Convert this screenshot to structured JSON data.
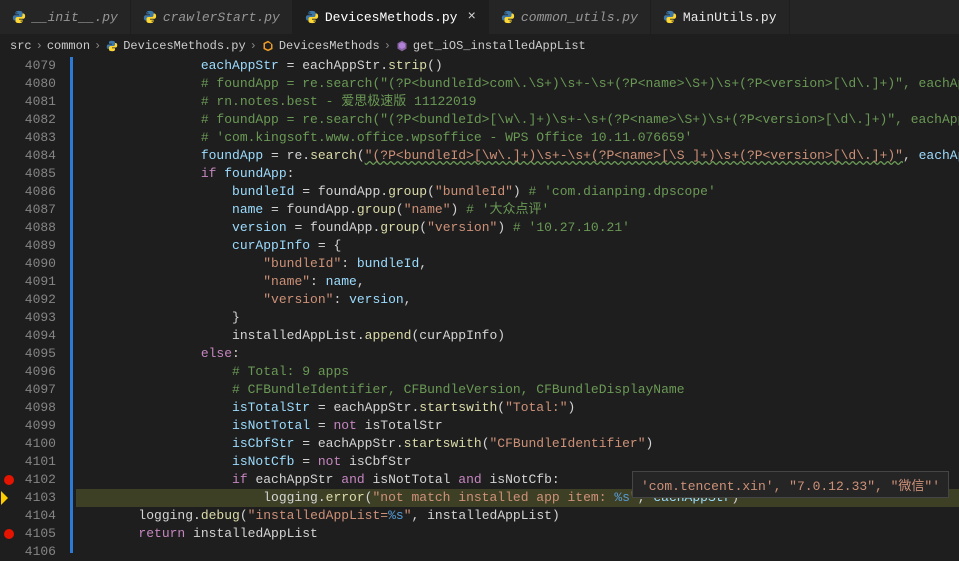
{
  "tabs": [
    {
      "label": "__init__.py",
      "state": "italic"
    },
    {
      "label": "crawlerStart.py",
      "state": "italic"
    },
    {
      "label": "DevicesMethods.py",
      "state": "active"
    },
    {
      "label": "common_utils.py",
      "state": "italic"
    },
    {
      "label": "MainUtils.py",
      "state": "normal"
    }
  ],
  "breadcrumbs": {
    "parts": [
      "src",
      "common",
      "DevicesMethods.py",
      "DevicesMethods",
      "get_iOS_installedAppList"
    ]
  },
  "lines": {
    "start": 4079,
    "end": 4106,
    "breakpoints": [
      4102,
      4105
    ],
    "current": 4103
  },
  "tooltip": "'com.tencent.xin', \"7.0.12.33\", \"微信\"'",
  "code": {
    "l4079": {
      "a": "eachAppStr = eachAppStr.strip()"
    },
    "l4080": {
      "cmt": "# foundApp = re.search(\"(?P<bundleId>com\\.\\S+)\\s+-\\s+(?P<name>\\S+)\\s+(?P<version>[\\d\\.]+)\", eachAppStr)"
    },
    "l4081": {
      "cmt": "# rn.notes.best - 爱思极速版 11122019"
    },
    "l4082": {
      "cmt": "# foundApp = re.search(\"(?P<bundleId>[\\w\\.]+)\\s+-\\s+(?P<name>\\S+)\\s+(?P<version>[\\d\\.]+)\", eachAppStr)"
    },
    "l4083": {
      "cmt": "# 'com.kingsoft.www.office.wpsoffice - WPS Office 10.11.076659'"
    },
    "l4084": {
      "a": "foundApp = re.search(",
      "str": "\"(?P<bundleId>[\\w\\.]+)\\s+-\\s+(?P<name>[\\S ]+)\\s+(?P<version>[\\d\\.]+)\"",
      "b": ", eachAppStr)"
    },
    "l4085": {
      "kw": "if",
      "rest": " foundApp:"
    },
    "l4086": {
      "a": "bundleId = foundApp.group(",
      "str": "\"bundleId\"",
      "b": ") ",
      "cmt": "# 'com.dianping.dpscope'"
    },
    "l4087": {
      "a": "name = foundApp.group(",
      "str": "\"name\"",
      "b": ") ",
      "cmt": "# '大众点评'"
    },
    "l4088": {
      "a": "version = foundApp.group(",
      "str": "\"version\"",
      "b": ") ",
      "cmt": "# '10.27.10.21'"
    },
    "l4089": {
      "a": "curAppInfo = {"
    },
    "l4090": {
      "str": "\"bundleId\"",
      "b": ": bundleId,"
    },
    "l4091": {
      "str": "\"name\"",
      "b": ": name,"
    },
    "l4092": {
      "str": "\"version\"",
      "b": ": version,"
    },
    "l4093": {
      "a": "}"
    },
    "l4094": {
      "a": "installedAppList.append(curAppInfo)"
    },
    "l4095": {
      "kw": "else",
      "rest": ":"
    },
    "l4096": {
      "cmt": "# Total: 9 apps"
    },
    "l4097": {
      "cmt": "# CFBundleIdentifier, CFBundleVersion, CFBundleDisplayName"
    },
    "l4098": {
      "a": "isTotalStr = eachAppStr.startswith(",
      "str": "\"Total:\"",
      "b": ")"
    },
    "l4099": {
      "a": "isNotTotal = ",
      "kw": "not",
      "b": " isTotalStr"
    },
    "l4100": {
      "a": "isCbfStr = eachAppStr.startswith(",
      "str": "\"CFBundleIdentifier\"",
      "b": ")"
    },
    "l4101": {
      "a": "isNotCfb = ",
      "kw": "not",
      "b": " isCbfStr"
    },
    "l4102": {
      "kw1": "if",
      "a": " eachAppStr ",
      "kw2": "and",
      "b": " isNotTotal ",
      "kw3": "and",
      "c": " isNotCfb:"
    },
    "l4103": {
      "a": "logging.error(",
      "str": "\"not match installed app item: ",
      "fmt": "%s",
      "str2": "\"",
      "b": ", eachAppStr)"
    },
    "l4104": {
      "a": "logging.debug(",
      "str": "\"installedAppList=",
      "fmt": "%s",
      "str2": "\"",
      "b": ", installedAppList)"
    },
    "l4105": {
      "kw": "return",
      "b": " installedAppList"
    }
  }
}
